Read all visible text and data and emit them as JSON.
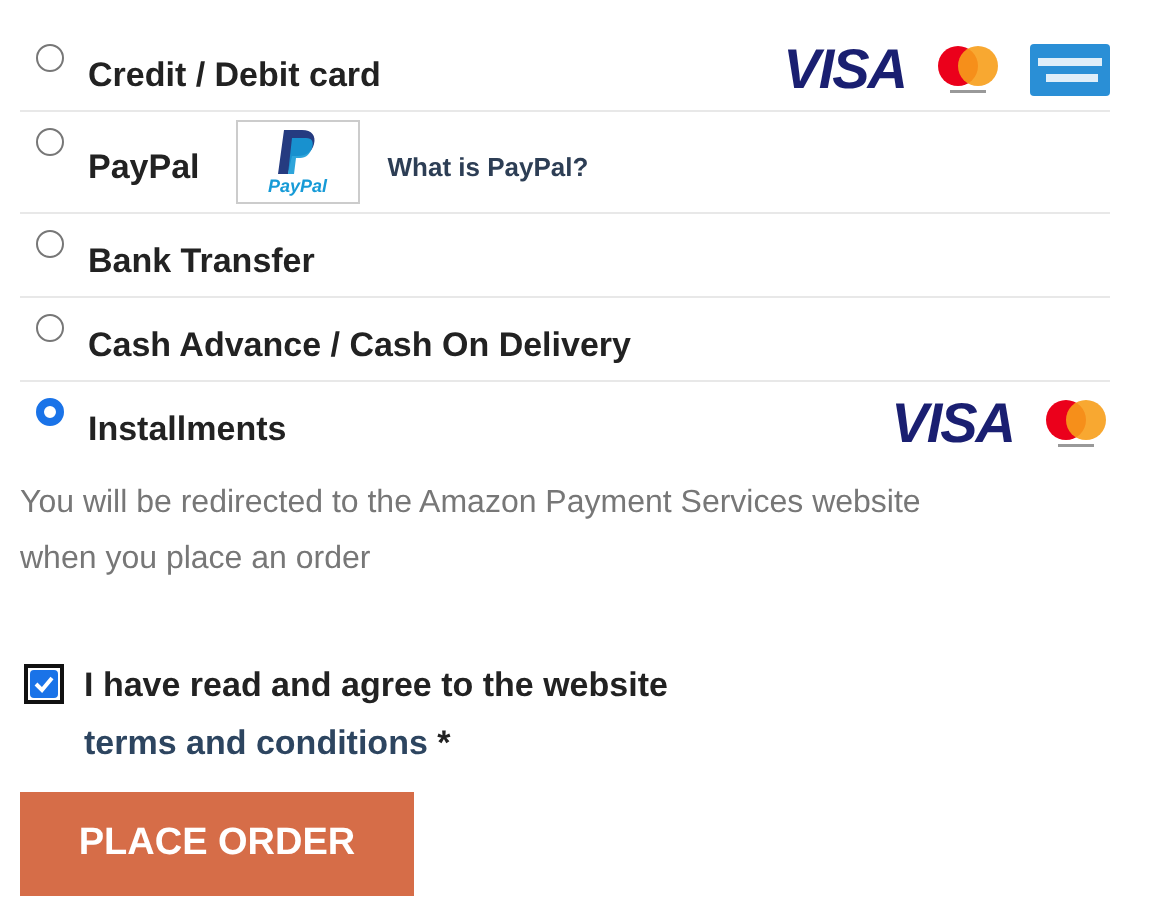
{
  "payment_methods": [
    {
      "label": "Credit / Debit card",
      "selected": false,
      "logos": [
        {
          "kind": "visa",
          "text": "VISA"
        },
        {
          "kind": "mastercard"
        },
        {
          "kind": "amex"
        }
      ]
    },
    {
      "label": "PayPal",
      "selected": false,
      "paypal_badge": {
        "text": "PayPal"
      },
      "link": "What is PayPal?"
    },
    {
      "label": "Bank Transfer",
      "selected": false
    },
    {
      "label": "Cash Advance / Cash On Delivery",
      "selected": false
    },
    {
      "label": "Installments",
      "selected": true,
      "logos": [
        {
          "kind": "visa",
          "text": "VISA"
        },
        {
          "kind": "mastercard"
        }
      ]
    }
  ],
  "description": "You will be redirected to the Amazon Payment Services website when you place an order",
  "terms": {
    "checked": true,
    "text": "I have read and agree to the website",
    "link": "terms and conditions",
    "required": "*"
  },
  "button": "PLACE ORDER"
}
